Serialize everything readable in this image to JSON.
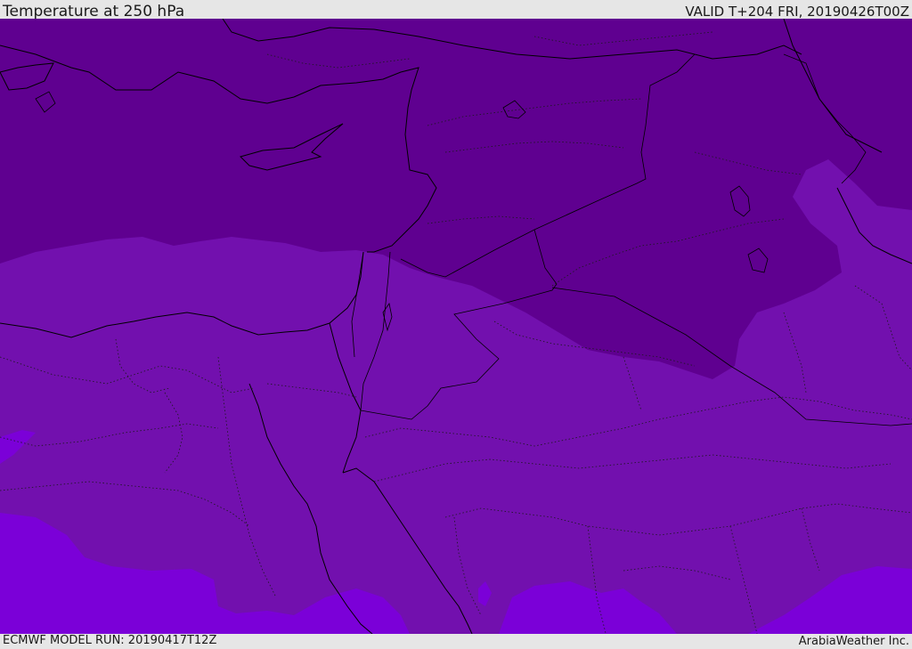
{
  "header": {
    "title": "Temperature at 250 hPa",
    "valid_time": "VALID T+204 FRI, 20190426T00Z"
  },
  "footer": {
    "model_run": "ECMWF MODEL RUN: 20190417T12Z",
    "credit": "ArabiaWeather Inc."
  },
  "colors": {
    "band_coldest": "#5f0090",
    "band_cold": "#7210ae",
    "band_cool": "#7b00d8",
    "band_warm_dark": "#6a0aa3",
    "coastline": "#000000",
    "border_dotted": "#1a1a1a",
    "frame": "#e6e6e6"
  }
}
